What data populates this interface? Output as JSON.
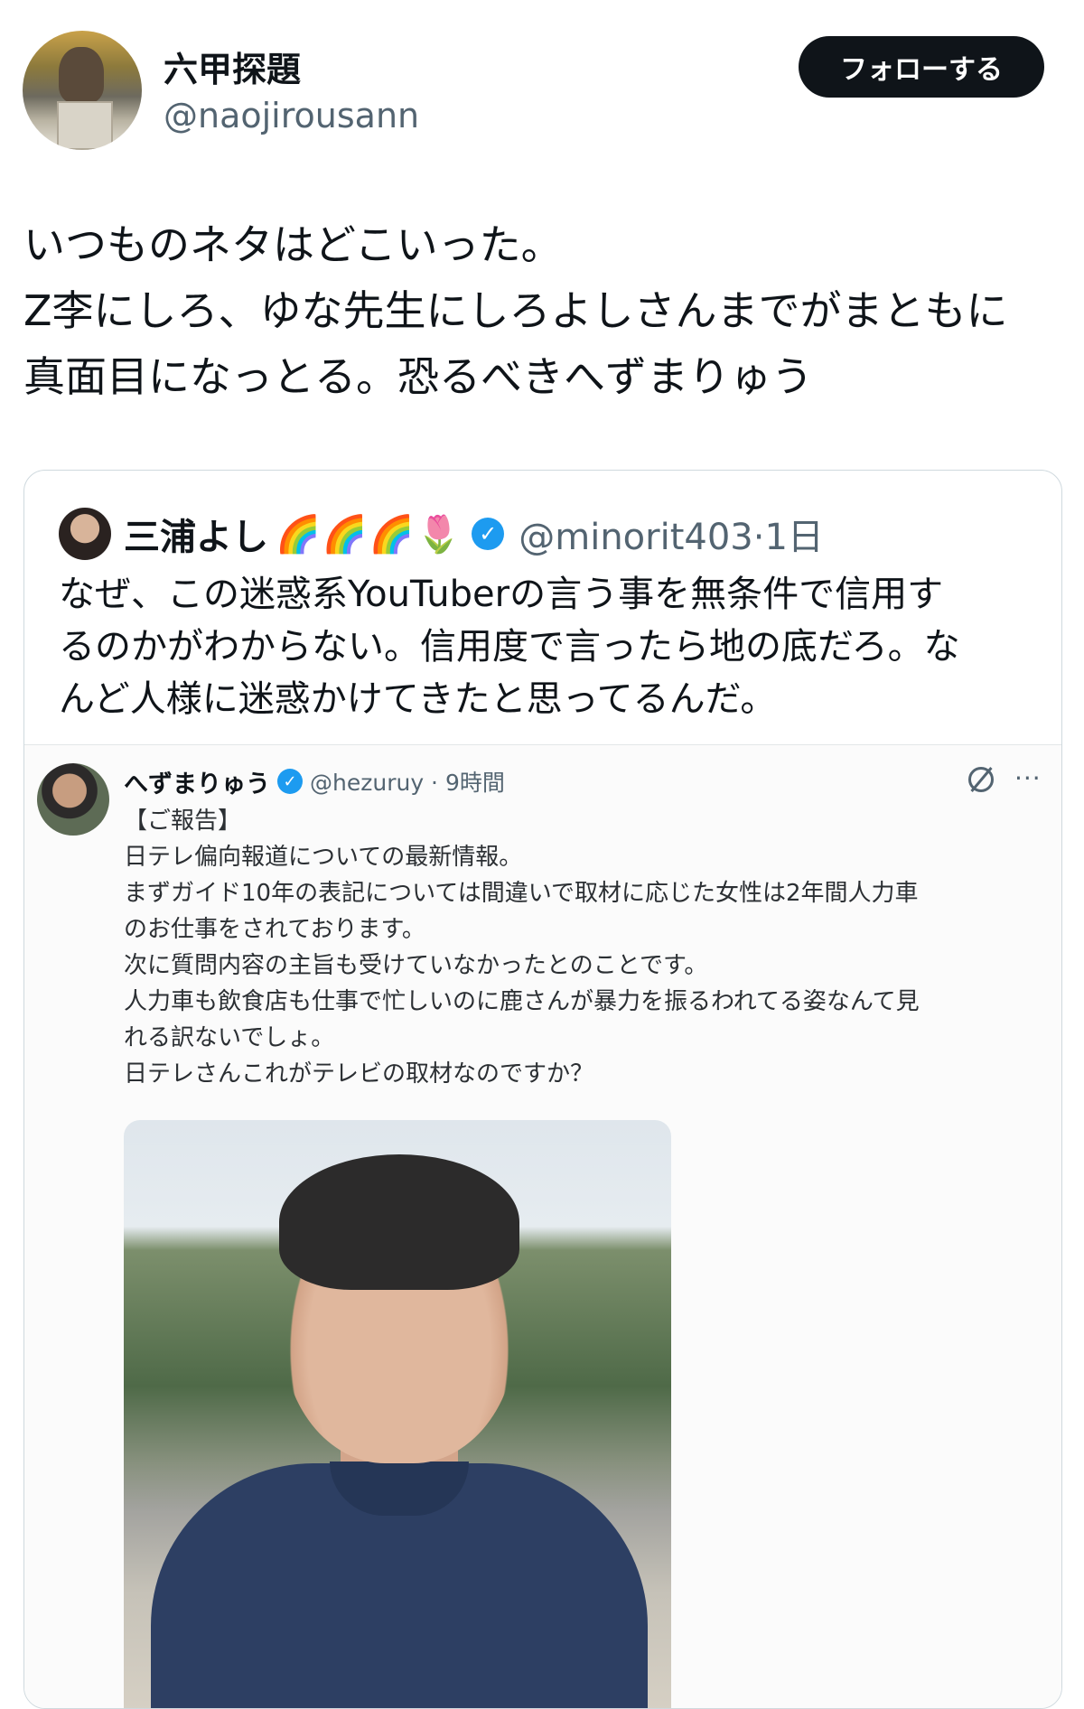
{
  "tweet": {
    "display_name": "六甲探題",
    "handle": "@naojirousann",
    "follow_label": "フォローする",
    "text_lines": [
      "いつものネタはどこいった。",
      "Z李にしろ、ゆな先生にしろよしさんまでがまともに",
      "真面目になっとる。恐るべきへずまりゅう"
    ]
  },
  "quote": {
    "display_name": "三浦よし",
    "emojis": [
      "🌈",
      "🌈",
      "🌈",
      "🌷"
    ],
    "handle_time": "@minorit403·1日",
    "text_lines": [
      "なぜ、この迷惑系YouTuberの言う事を無条件で信用す",
      "るのかがわからない。信用度で言ったら地の底だろ。な",
      "んど人様に迷惑かけてきたと思ってるんだ。"
    ]
  },
  "embedded": {
    "display_name": "へずまりゅう",
    "meta": "@hezuruy · 9時間",
    "more_label": "···",
    "text_lines": [
      "【ご報告】",
      "日テレ偏向報道についての最新情報。",
      "まずガイド10年の表記については間違いで取材に応じた女性は2年間人力車",
      "のお仕事をされております。",
      "次に質問内容の主旨も受けていなかったとのことです。",
      "人力車も飲食店も仕事で忙しいのに鹿さんが暴力を振るわれてる姿なんて見",
      "れる訳ないでしょ。",
      "日テレさんこれがテレビの取材なのですか？"
    ]
  },
  "colors": {
    "text": "#0f1419",
    "secondary": "#536471",
    "follow_bg": "#0f1419",
    "verified": "#1d9bf0",
    "border": "#cfd9de"
  }
}
